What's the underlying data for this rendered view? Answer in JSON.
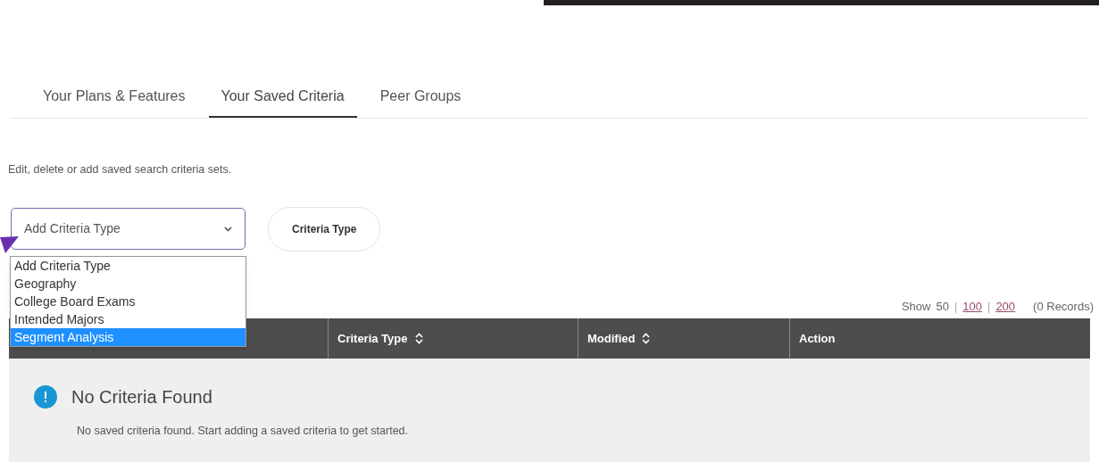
{
  "tabs": [
    {
      "label": "Your Plans & Features",
      "selected": false
    },
    {
      "label": "Your Saved Criteria",
      "selected": true
    },
    {
      "label": "Peer Groups",
      "selected": false
    }
  ],
  "description": "Edit, delete or add saved search criteria sets.",
  "criteria_select": {
    "value": "Add Criteria Type",
    "expanded": true,
    "options": [
      {
        "label": "Add Criteria Type",
        "highlighted": false
      },
      {
        "label": "Geography",
        "highlighted": false
      },
      {
        "label": "College Board Exams",
        "highlighted": false
      },
      {
        "label": "Intended Majors",
        "highlighted": false
      },
      {
        "label": "Segment Analysis",
        "highlighted": true
      }
    ]
  },
  "criteria_type_button": "Criteria Type",
  "pagination": {
    "label": "Show",
    "options": [
      {
        "label": "50",
        "selected": true
      },
      {
        "label": "100",
        "selected": false
      },
      {
        "label": "200",
        "selected": false
      }
    ],
    "separator": "|",
    "records": "(0 Records)"
  },
  "table": {
    "columns": [
      {
        "label": "Criteria Type",
        "sortable": true
      },
      {
        "label": "Modified",
        "sortable": true
      },
      {
        "label": "Action",
        "sortable": false
      }
    ],
    "empty": {
      "title": "No Criteria Found",
      "message": "No saved criteria found. Start adding a saved criteria to get started."
    }
  }
}
